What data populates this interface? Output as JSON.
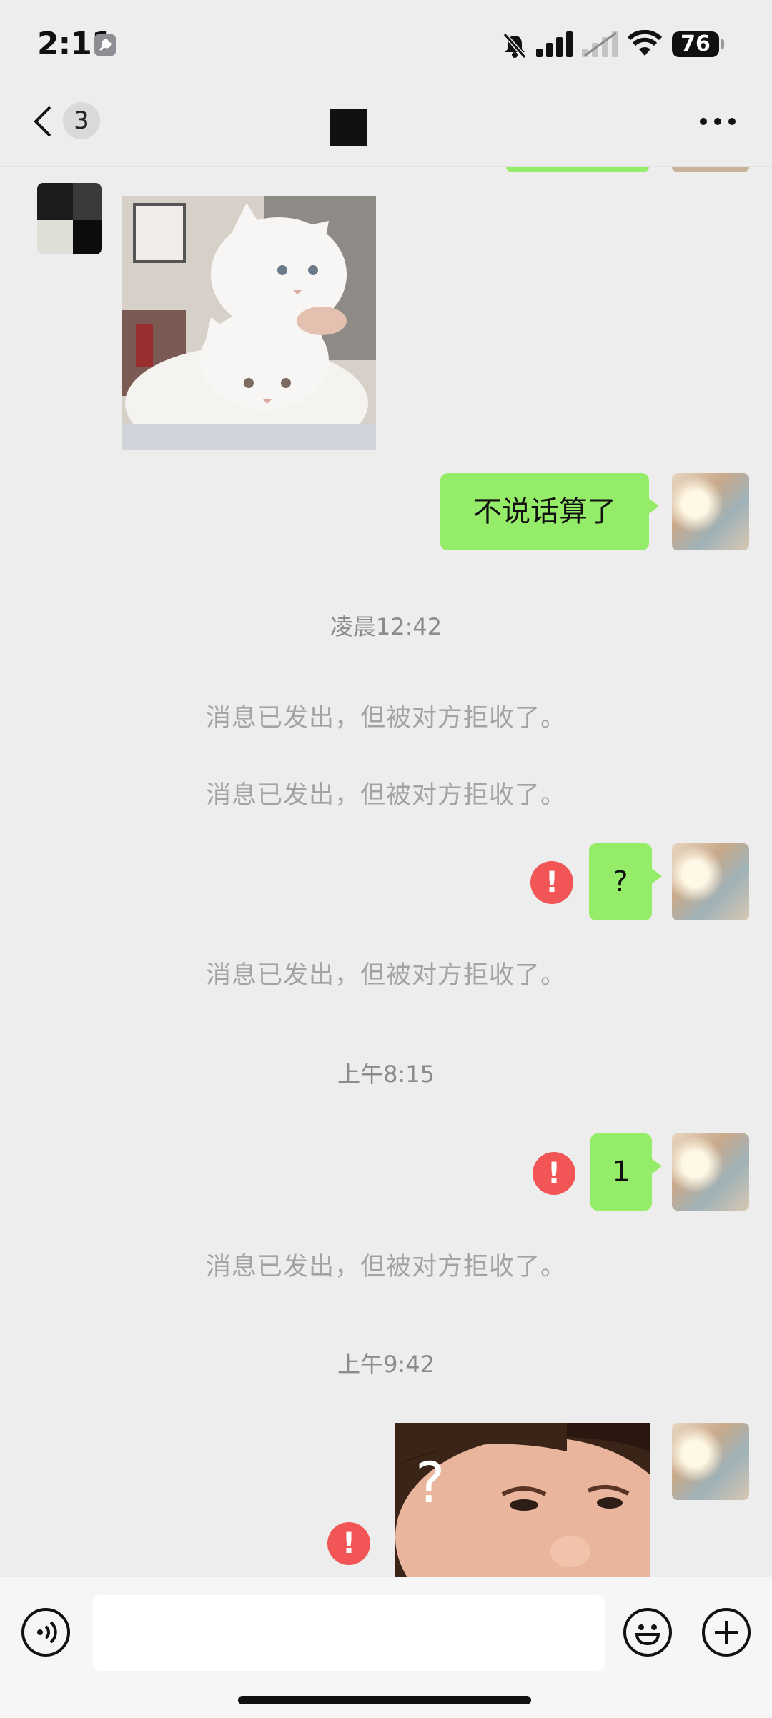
{
  "status_bar": {
    "time": "2:11",
    "battery": "76"
  },
  "nav": {
    "unread_count": "3"
  },
  "chat": {
    "messages": [
      {
        "type": "received_image",
        "description_icon": "cat-photo"
      },
      {
        "type": "sent_text",
        "text": "不说话算了"
      },
      {
        "type": "timestamp",
        "text": "凌晨12:42"
      },
      {
        "type": "system",
        "text": "消息已发出，但被对方拒收了。"
      },
      {
        "type": "system",
        "text": "消息已发出，但被对方拒收了。"
      },
      {
        "type": "sent_text_failed",
        "text": "?"
      },
      {
        "type": "system",
        "text": "消息已发出，但被对方拒收了。"
      },
      {
        "type": "timestamp",
        "text": "上午8:15"
      },
      {
        "type": "sent_text_failed",
        "text": "1"
      },
      {
        "type": "system",
        "text": "消息已发出，但被对方拒收了。"
      },
      {
        "type": "timestamp",
        "text": "上午9:42"
      },
      {
        "type": "sent_image_failed",
        "overlay_text": "?"
      }
    ],
    "error_mark": "!"
  },
  "input_bar": {
    "voice_icon": "voice-icon",
    "emoji_icon": "emoji-icon",
    "plus_icon": "plus-icon"
  },
  "colors": {
    "bubble_green": "#95ec69",
    "error_red": "#f25555",
    "background": "#ededed"
  }
}
